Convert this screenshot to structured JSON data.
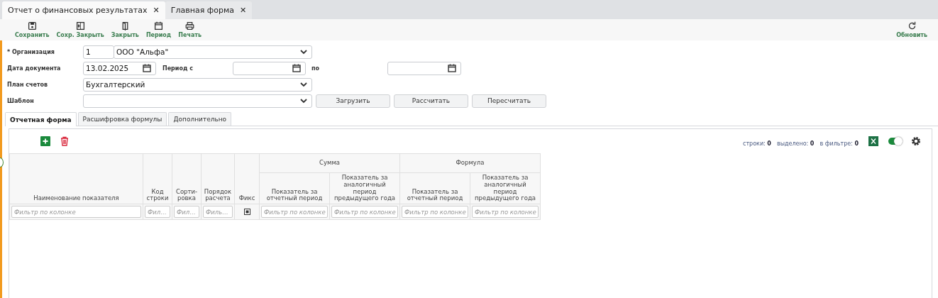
{
  "window_tabs": [
    {
      "label": "Отчет о финансовых результатах",
      "selected": true,
      "close": "✕"
    },
    {
      "label": "Главная форма",
      "selected": false,
      "close": "✕"
    }
  ],
  "toolbar": {
    "buttons": [
      {
        "label": "Сохранить",
        "kind": "save"
      },
      {
        "label": "Сохр. Закрыть",
        "kind": "saveclose"
      },
      {
        "label": "Закрыть",
        "kind": "close"
      },
      {
        "label": "Период",
        "kind": "period"
      },
      {
        "label": "Печать",
        "kind": "print"
      }
    ],
    "refresh": {
      "label": "Обновить"
    }
  },
  "form": {
    "organization": {
      "label": "* Организация",
      "code": "1",
      "name": "ООО \"Альфа\""
    },
    "document_date": {
      "label": "Дата документа",
      "value": "13.02.2025"
    },
    "period_from": {
      "label": "Период с"
    },
    "period_to": {
      "label": "по"
    },
    "chart_of_accounts": {
      "label": "План счетов",
      "value": "Бухгалтерский"
    },
    "template": {
      "label": "Шаблон"
    },
    "buttons": [
      "Загрузить",
      "Рассчитать",
      "Пересчитать"
    ]
  },
  "tabs": [
    {
      "label": "Отчетная форма",
      "selected": true
    },
    {
      "label": "Расшифровка формулы",
      "selected": false
    },
    {
      "label": "Дополнительно",
      "selected": false
    }
  ],
  "grid_toolbar": {
    "counters": [
      {
        "label": "строки:",
        "value": "0"
      },
      {
        "label": "выделено:",
        "value": "0"
      },
      {
        "label": "в фильтре:",
        "value": "0"
      }
    ],
    "toggle_on": true
  },
  "table": {
    "columns": [
      {
        "title": "Наименование показателя",
        "filter": "Фильтр по колонке"
      },
      {
        "title": "Код строки",
        "filter": "Фил…"
      },
      {
        "title": "Сорти-ровка",
        "filter": "Фил…"
      },
      {
        "title": "Порядок расчета",
        "filter": "Филь…"
      },
      {
        "title": "Фикс",
        "kind": "check",
        "indeterminate": true
      }
    ],
    "groups": [
      {
        "title": "Сумма",
        "columns": [
          {
            "title": "Показатель за отчетный период",
            "filter": "Фильтр по колонке"
          },
          {
            "title": "Показатель за аналогичный период предыдущего года",
            "filter": "Фильтр по колонке"
          }
        ]
      },
      {
        "title": "Формула",
        "columns": [
          {
            "title": "Показатель за отчетный период",
            "filter": "Фильтр по колонке"
          },
          {
            "title": "Показатель за аналогичный период предыдущего года",
            "filter": "Фильтр по колонке"
          }
        ]
      }
    ]
  }
}
